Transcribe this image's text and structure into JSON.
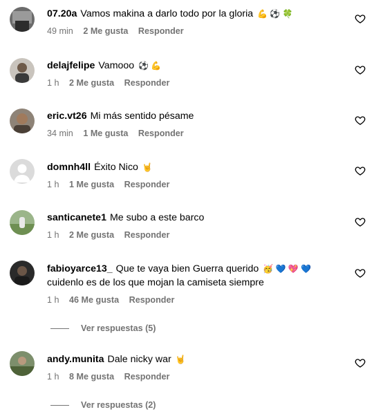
{
  "comments": [
    {
      "user": "07.20a",
      "text": "Vamos makina a darlo todo por la gloria",
      "emoji": "💪 ⚽ 🍀",
      "time": "49 min",
      "likes": "2 Me gusta",
      "reply": "Responder"
    },
    {
      "user": "delajfelipe",
      "text": "Vamooo",
      "emoji": "⚽ 💪",
      "time": "1 h",
      "likes": "2 Me gusta",
      "reply": "Responder"
    },
    {
      "user": "eric.vt26",
      "text": "Mi más sentido pésame",
      "emoji": "",
      "time": "34 min",
      "likes": "1 Me gusta",
      "reply": "Responder"
    },
    {
      "user": "domnh4ll",
      "text": "Éxito Nico",
      "emoji": "🤘",
      "time": "1 h",
      "likes": "1 Me gusta",
      "reply": "Responder"
    },
    {
      "user": "santicanete1",
      "text": "Me subo a este barco",
      "emoji": "",
      "time": "1 h",
      "likes": "2 Me gusta",
      "reply": "Responder"
    },
    {
      "user": "fabioyarce13_",
      "text": "Que te vaya bien Guerra querido",
      "emoji": "🥳 💙 💖 💙",
      "text2": "cuidenlo es de los que mojan la camiseta siempre",
      "time": "1 h",
      "likes": "46 Me gusta",
      "reply": "Responder",
      "replies": "Ver respuestas (5)"
    },
    {
      "user": "andy.munita",
      "text": "Dale nicky war",
      "emoji": "🤘",
      "time": "1 h",
      "likes": "8 Me gusta",
      "reply": "Responder",
      "replies": "Ver respuestas (2)"
    }
  ],
  "colors": {
    "meta": "#737373",
    "text": "#000000"
  },
  "icons": {
    "like": "heart-outline-icon"
  }
}
